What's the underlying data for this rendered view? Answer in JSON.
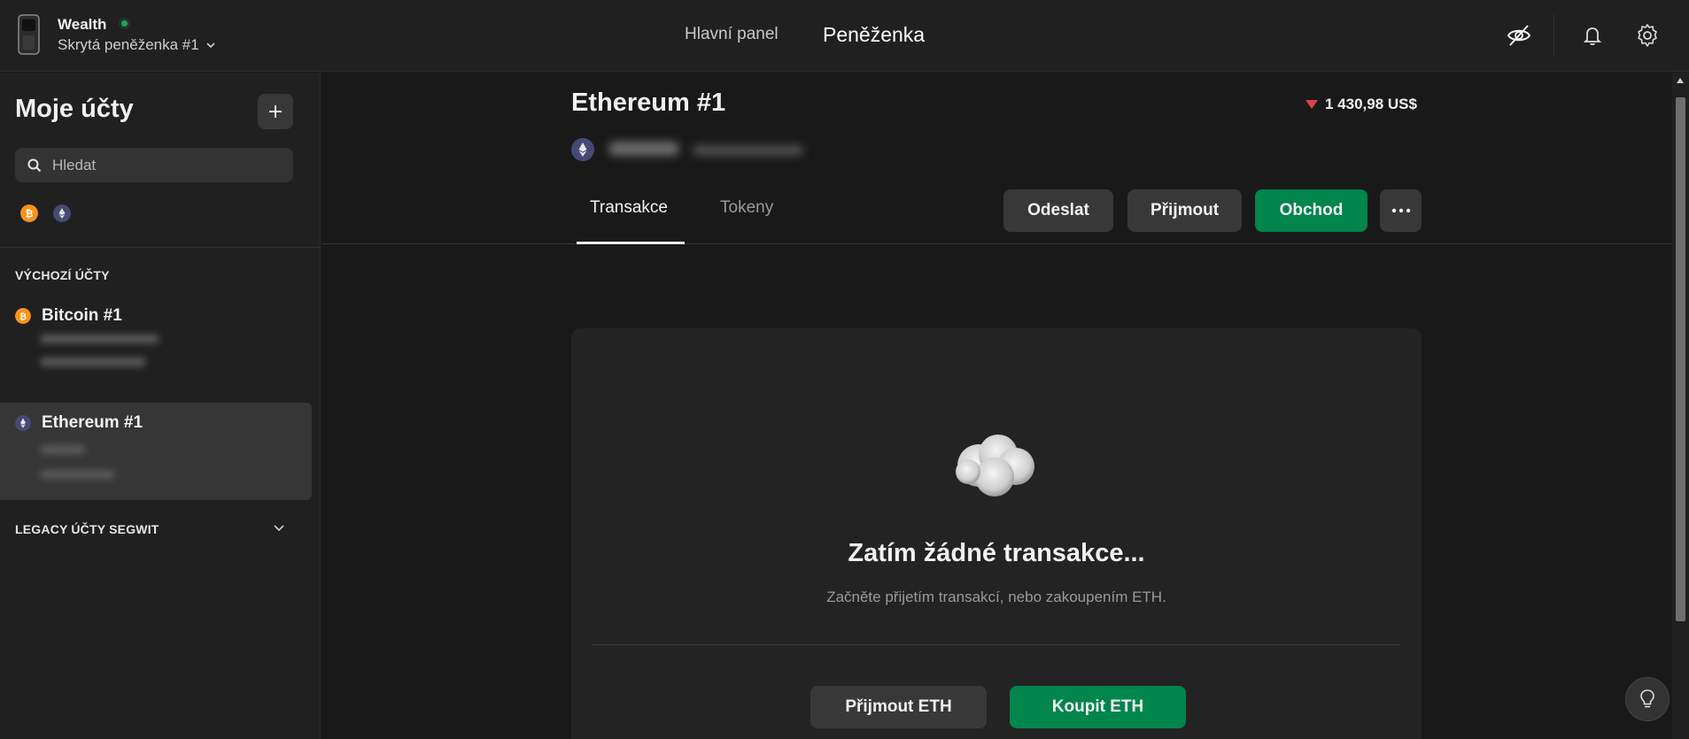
{
  "header": {
    "wallet_name": "Wealth",
    "wallet_sub": "Skrytá peněženka #1",
    "nav_dashboard": "Hlavní panel",
    "nav_wallet": "Peněženka",
    "icons": [
      "device-icon",
      "hide-balances-icon",
      "bell-icon",
      "gear-icon"
    ],
    "status_color": "#1fa35a"
  },
  "sidebar": {
    "title": "Moje účty",
    "search_placeholder": "Hledat",
    "coin_filters": [
      "bitcoin-icon",
      "ethereum-icon"
    ],
    "sections": {
      "default": "VÝCHOZÍ ÚČTY",
      "legacy": "LEGACY ÚČTY SEGWIT"
    },
    "accounts": [
      {
        "name": "Bitcoin #1",
        "coin": "bitcoin",
        "active": false
      },
      {
        "name": "Ethereum #1",
        "coin": "ethereum",
        "active": true
      }
    ]
  },
  "account": {
    "title": "Ethereum #1",
    "balance_change": "1 430,98 US$",
    "balance_trend": "down",
    "tabs": [
      "Transakce",
      "Tokeny"
    ],
    "active_tab": "Transakce",
    "actions": {
      "send": "Odeslat",
      "receive": "Přijmout",
      "trade": "Obchod",
      "more": "···"
    }
  },
  "empty_state": {
    "title": "Zatím žádné transakce...",
    "subtitle": "Začněte přijetím transakcí, nebo zakoupením ETH.",
    "receive_button": "Přijmout ETH",
    "buy_button": "Koupit ETH"
  },
  "colors": {
    "accent_green": "#00854d",
    "trend_down": "#d8444a",
    "bitcoin": "#f7931a",
    "ethereum": "#454a75"
  }
}
